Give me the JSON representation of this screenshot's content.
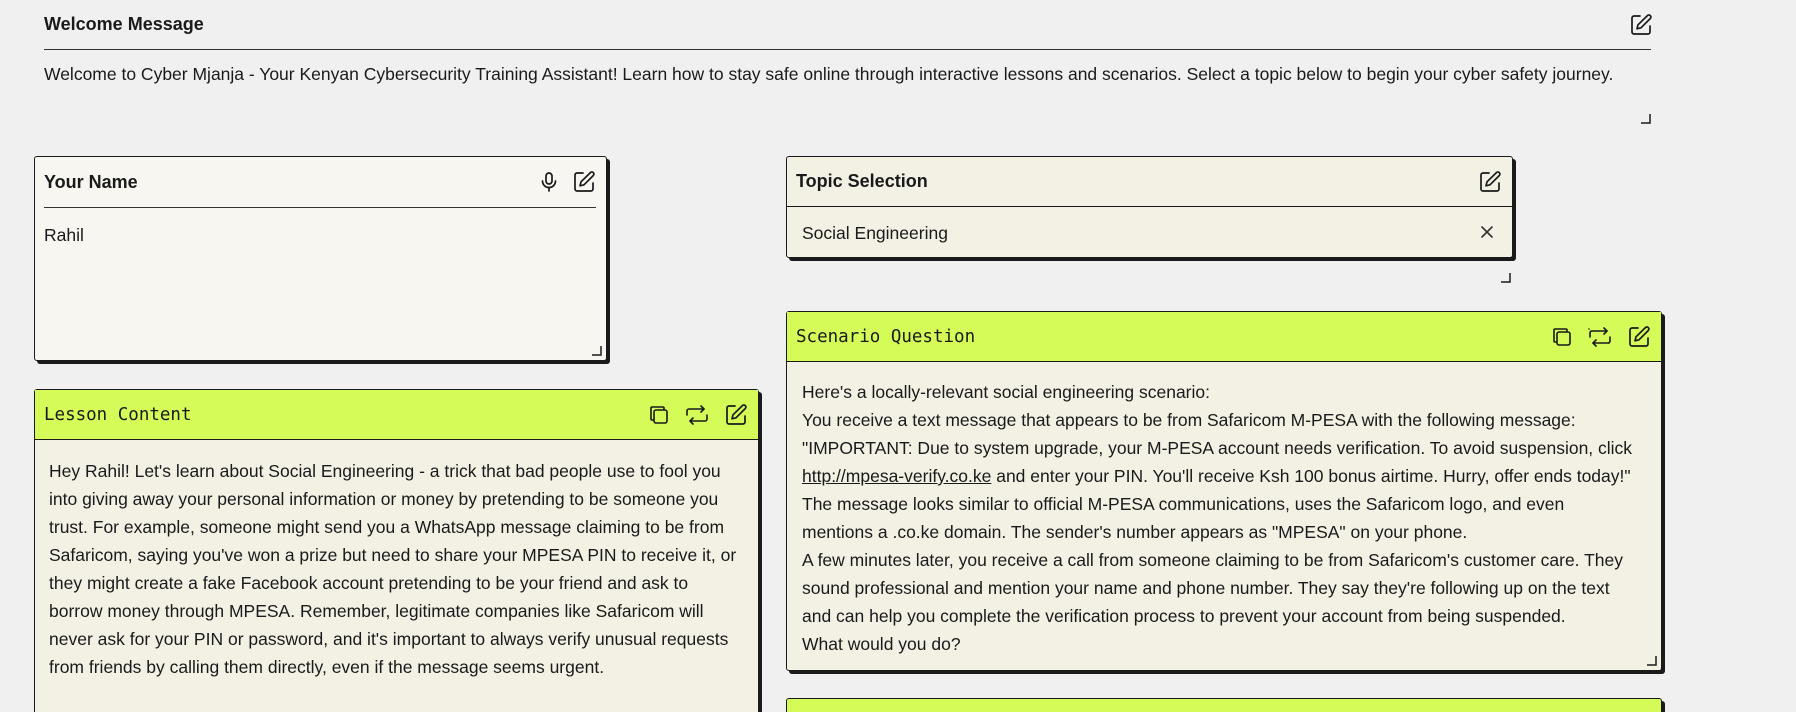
{
  "welcome": {
    "title": "Welcome Message",
    "text": "Welcome to Cyber Mjanja - Your Kenyan Cybersecurity Training Assistant! Learn how to stay safe online through interactive lessons and scenarios. Select a topic below to begin your cyber safety journey."
  },
  "name": {
    "label": "Your Name",
    "value": "Rahil"
  },
  "topic": {
    "label": "Topic Selection",
    "value": "Social Engineering"
  },
  "scenario": {
    "label": "Scenario Question",
    "lines": [
      "Here's a locally-relevant social engineering scenario:",
      "You receive a text message that appears to be from Safaricom M-PESA with the following message:",
      "\"IMPORTANT: Due to system upgrade, your M-PESA account needs verification. To avoid suspension, click",
      "",
      "The message looks similar to official M-PESA communications, uses the Safaricom logo, and even",
      "mentions a .co.ke domain. The sender's number appears as \"MPESA\" on your phone.",
      "A few minutes later, you receive a call from someone claiming to be from Safaricom's customer care. They",
      "sound professional and mention your name and phone number. They say they're following up on the text",
      "and can help you complete the verification process to prevent your account from being suspended.",
      "What would you do?"
    ],
    "link": "http://mpesa-verify.co.ke",
    "link_tail": " and enter your PIN. You'll receive Ksh 100 bonus airtime. Hurry, offer ends today!\""
  },
  "lesson": {
    "label": "Lesson Content",
    "lines": [
      "Hey Rahil! Let's learn about Social Engineering - a trick that bad people use to fool you",
      "into giving away your personal information or money by pretending to be someone you",
      "trust. For example, someone might send you a WhatsApp message claiming to be from",
      "Safaricom, saying you've won a prize but need to share your MPESA PIN to receive it, or",
      "they might create a fake Facebook account pretending to be your friend and ask to",
      "borrow money through MPESA. Remember, legitimate companies like Safaricom will",
      "never ask for your PIN or password, and it's important to always verify unusual requests",
      "from friends by calling them directly, even if the message seems urgent."
    ]
  },
  "colors": {
    "accent": "#d4fb58",
    "background": "#f0f0f0",
    "card": "#f3f0e4"
  },
  "icons": [
    "edit-icon",
    "microphone-icon",
    "copy-icon",
    "retry-icon",
    "close-icon",
    "resize-handle-icon"
  ]
}
